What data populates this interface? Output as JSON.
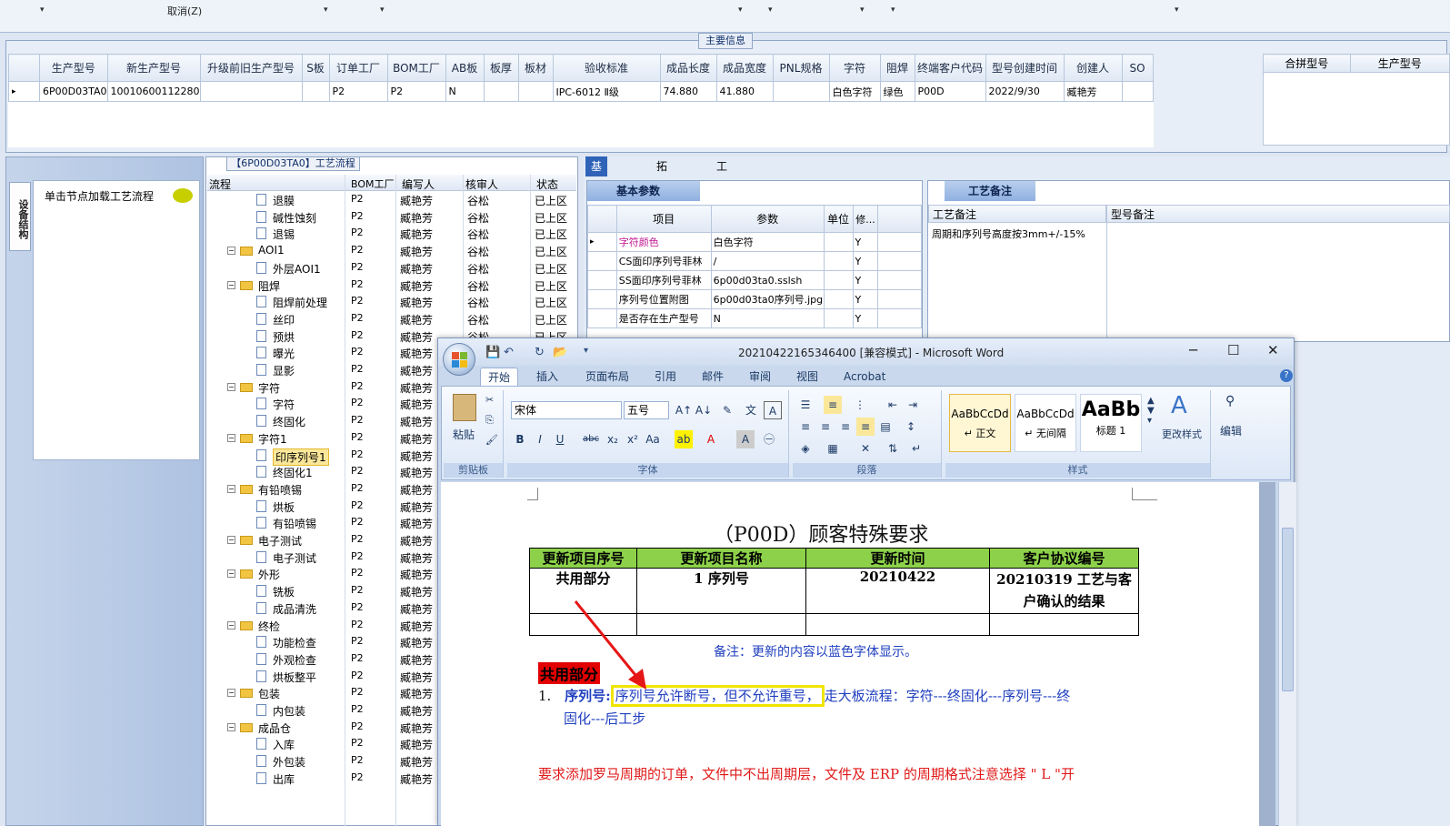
{
  "top": {
    "cancel_label": "取消(Z)"
  },
  "main_info": {
    "group_title": "主要信息",
    "columns": [
      "生产型号",
      "新生产型号",
      "升级前旧生产型号",
      "S板",
      "订单工厂",
      "BOM工厂",
      "AB板",
      "板厚",
      "板材",
      "验收标准",
      "成品长度",
      "成品宽度",
      "PNL规格",
      "字符",
      "阻焊",
      "终端客户代码",
      "型号创建时间",
      "创建人",
      "SO"
    ],
    "row": [
      "6P00D03TA0",
      "10010600112280",
      "",
      "",
      "P2",
      "P2",
      "N",
      "",
      "",
      "IPC-6012 Ⅱ级",
      "74.880",
      "41.880",
      "",
      "白色字符",
      "绿色",
      "P00D",
      "2022/9/30",
      "臧艳芳",
      ""
    ],
    "side_columns": [
      "合拼型号",
      "生产型号"
    ]
  },
  "left": {
    "vtab": "设备结构",
    "hint": "单击节点加载工艺流程"
  },
  "tree": {
    "title": "【6P00D03TA0】工艺流程",
    "headers": [
      "流程",
      "BOM工厂",
      "编写人",
      "核审人",
      "状态"
    ],
    "rows": [
      {
        "name": "退膜",
        "level": 2,
        "folder": false,
        "factory": "P2",
        "writer": "臧艳芳",
        "reviewer": "谷松",
        "status": "已上区"
      },
      {
        "name": "碱性蚀刻",
        "level": 2,
        "folder": false,
        "factory": "P2",
        "writer": "臧艳芳",
        "reviewer": "谷松",
        "status": "已上区"
      },
      {
        "name": "退锡",
        "level": 2,
        "folder": false,
        "factory": "P2",
        "writer": "臧艳芳",
        "reviewer": "谷松",
        "status": "已上区"
      },
      {
        "name": "AOI1",
        "level": 1,
        "folder": true,
        "factory": "P2",
        "writer": "臧艳芳",
        "reviewer": "谷松",
        "status": "已上区"
      },
      {
        "name": "外层AOI1",
        "level": 2,
        "folder": false,
        "factory": "P2",
        "writer": "臧艳芳",
        "reviewer": "谷松",
        "status": "已上区"
      },
      {
        "name": "阻焊",
        "level": 1,
        "folder": true,
        "factory": "P2",
        "writer": "臧艳芳",
        "reviewer": "谷松",
        "status": "已上区"
      },
      {
        "name": "阻焊前处理",
        "level": 2,
        "folder": false,
        "factory": "P2",
        "writer": "臧艳芳",
        "reviewer": "谷松",
        "status": "已上区"
      },
      {
        "name": "丝印",
        "level": 2,
        "folder": false,
        "factory": "P2",
        "writer": "臧艳芳",
        "reviewer": "谷松",
        "status": "已上区"
      },
      {
        "name": "预烘",
        "level": 2,
        "folder": false,
        "factory": "P2",
        "writer": "臧艳芳",
        "reviewer": "谷松",
        "status": "已上区"
      },
      {
        "name": "曝光",
        "level": 2,
        "folder": false,
        "factory": "P2",
        "writer": "臧艳芳",
        "reviewer": "",
        "status": ""
      },
      {
        "name": "显影",
        "level": 2,
        "folder": false,
        "factory": "P2",
        "writer": "臧艳芳",
        "reviewer": "",
        "status": ""
      },
      {
        "name": "字符",
        "level": 1,
        "folder": true,
        "factory": "P2",
        "writer": "臧艳芳",
        "reviewer": "",
        "status": ""
      },
      {
        "name": "字符",
        "level": 2,
        "folder": false,
        "factory": "P2",
        "writer": "臧艳芳",
        "reviewer": "",
        "status": ""
      },
      {
        "name": "终固化",
        "level": 2,
        "folder": false,
        "factory": "P2",
        "writer": "臧艳芳",
        "reviewer": "",
        "status": ""
      },
      {
        "name": "字符1",
        "level": 1,
        "folder": true,
        "factory": "P2",
        "writer": "臧艳芳",
        "reviewer": "",
        "status": ""
      },
      {
        "name": "印序列号1",
        "level": 2,
        "folder": false,
        "factory": "P2",
        "writer": "臧艳芳",
        "reviewer": "",
        "status": "",
        "selected": true
      },
      {
        "name": "终固化1",
        "level": 2,
        "folder": false,
        "factory": "P2",
        "writer": "臧艳芳",
        "reviewer": "",
        "status": ""
      },
      {
        "name": "有铅喷锡",
        "level": 1,
        "folder": true,
        "factory": "P2",
        "writer": "臧艳芳",
        "reviewer": "",
        "status": ""
      },
      {
        "name": "烘板",
        "level": 2,
        "folder": false,
        "factory": "P2",
        "writer": "臧艳芳",
        "reviewer": "",
        "status": ""
      },
      {
        "name": "有铅喷锡",
        "level": 2,
        "folder": false,
        "factory": "P2",
        "writer": "臧艳芳",
        "reviewer": "",
        "status": ""
      },
      {
        "name": "电子测试",
        "level": 1,
        "folder": true,
        "factory": "P2",
        "writer": "臧艳芳",
        "reviewer": "",
        "status": ""
      },
      {
        "name": "电子测试",
        "level": 2,
        "folder": false,
        "factory": "P2",
        "writer": "臧艳芳",
        "reviewer": "",
        "status": ""
      },
      {
        "name": "外形",
        "level": 1,
        "folder": true,
        "factory": "P2",
        "writer": "臧艳芳",
        "reviewer": "",
        "status": ""
      },
      {
        "name": "铣板",
        "level": 2,
        "folder": false,
        "factory": "P2",
        "writer": "臧艳芳",
        "reviewer": "",
        "status": ""
      },
      {
        "name": "成品清洗",
        "level": 2,
        "folder": false,
        "factory": "P2",
        "writer": "臧艳芳",
        "reviewer": "",
        "status": ""
      },
      {
        "name": "终检",
        "level": 1,
        "folder": true,
        "factory": "P2",
        "writer": "臧艳芳",
        "reviewer": "",
        "status": ""
      },
      {
        "name": "功能检查",
        "level": 2,
        "folder": false,
        "factory": "P2",
        "writer": "臧艳芳",
        "reviewer": "",
        "status": ""
      },
      {
        "name": "外观检查",
        "level": 2,
        "folder": false,
        "factory": "P2",
        "writer": "臧艳芳",
        "reviewer": "",
        "status": ""
      },
      {
        "name": "烘板整平",
        "level": 2,
        "folder": false,
        "factory": "P2",
        "writer": "臧艳芳",
        "reviewer": "",
        "status": ""
      },
      {
        "name": "包装",
        "level": 1,
        "folder": true,
        "factory": "P2",
        "writer": "臧艳芳",
        "reviewer": "",
        "status": ""
      },
      {
        "name": "内包装",
        "level": 2,
        "folder": false,
        "factory": "P2",
        "writer": "臧艳芳",
        "reviewer": "",
        "status": ""
      },
      {
        "name": "成品仓",
        "level": 1,
        "folder": true,
        "factory": "P2",
        "writer": "臧艳芳",
        "reviewer": "",
        "status": ""
      },
      {
        "name": "入库",
        "level": 2,
        "folder": false,
        "factory": "P2",
        "writer": "臧艳芳",
        "reviewer": "",
        "status": ""
      },
      {
        "name": "外包装",
        "level": 2,
        "folder": false,
        "factory": "P2",
        "writer": "臧艳芳",
        "reviewer": "",
        "status": ""
      },
      {
        "name": "出库",
        "level": 2,
        "folder": false,
        "factory": "P2",
        "writer": "臧艳芳",
        "reviewer": "",
        "status": ""
      }
    ]
  },
  "right": {
    "tabs": [
      "基本信息",
      "拓展信息",
      "工时"
    ],
    "params_title": "基本参数",
    "params_headers": [
      "项目",
      "参数",
      "单位",
      "修..."
    ],
    "params_rows": [
      [
        "字符颜色",
        "白色字符",
        "",
        "Y"
      ],
      [
        "CS面印序列号菲林",
        "/",
        "",
        "Y"
      ],
      [
        "SS面印序列号菲林",
        "6p00d03ta0.sslsh",
        "",
        "Y"
      ],
      [
        "序列号位置附图",
        "6p00d03ta0序列号.jpg",
        "",
        "Y"
      ],
      [
        "是否存在生产型号",
        "N",
        "",
        "Y"
      ]
    ],
    "notes_title": "工艺备注",
    "notes_cols": [
      "工艺备注",
      "型号备注"
    ],
    "notes_value": "周期和序列号高度按3mm+/-15%"
  },
  "word": {
    "title": "20210422165346400 [兼容模式] - Microsoft Word",
    "tabs": [
      "开始",
      "插入",
      "页面布局",
      "引用",
      "邮件",
      "审阅",
      "视图",
      "Acrobat"
    ],
    "clipboard": {
      "paste": "粘贴",
      "label": "剪贴板"
    },
    "font": {
      "name": "宋体",
      "size": "五号",
      "label": "字体"
    },
    "paragraph_label": "段落",
    "styles": [
      {
        "sample": "AaBbCcDd",
        "name": "↵ 正文"
      },
      {
        "sample": "AaBbCcDd",
        "name": "↵ 无间隔"
      },
      {
        "sample": "AaBb",
        "name": "标题 1"
      }
    ],
    "styles_label": "样式",
    "change_styles": "更改样式",
    "edit": "编辑",
    "doc": {
      "title": "（P00D）顾客特殊要求",
      "table_headers": [
        "更新项目序号",
        "更新项目名称",
        "更新时间",
        "客户协议编号"
      ],
      "table_row": [
        "共用部分",
        "1 序列号",
        "20210422",
        "20210319 工艺与客户确认的结果"
      ],
      "note": "备注：更新的内容以蓝色字体显示。",
      "section": "共用部分",
      "item_num": "1.",
      "item_label": "序列号:",
      "item_highlight": "序列号允许断号，但不允许重号，",
      "item_rest": "走大板流程：字符---终固化---序列号---终",
      "item_line2": "固化---后工步",
      "red_text": "要求添加罗马周期的订单，文件中不出周期层，文件及 ERP 的周期格式注意选择 \" L \"开"
    }
  }
}
